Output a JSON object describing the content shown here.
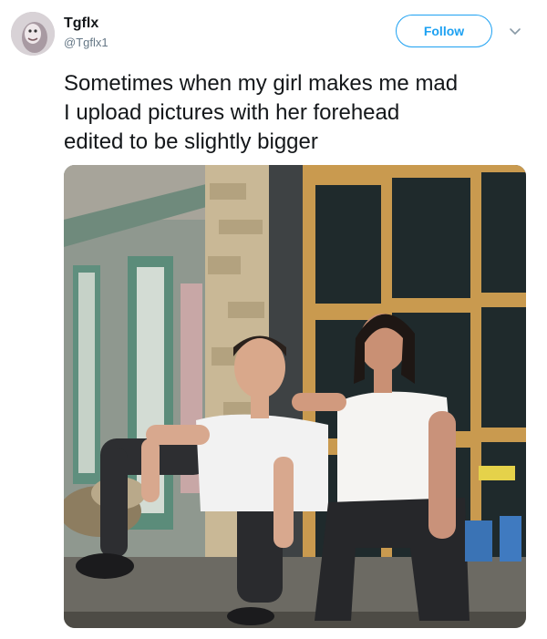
{
  "author": {
    "name": "Tgflx",
    "handle": "@Tgflx1"
  },
  "follow_label": "Follow",
  "tweet_text_lines": [
    "Sometimes when my girl makes me mad",
    "I upload pictures with her forehead",
    "edited to be slightly bigger"
  ],
  "colors": {
    "accent": "#1da1f2",
    "text": "#14171a",
    "secondary_text": "#657786"
  },
  "icons": {
    "more": "chevron-down-icon"
  }
}
